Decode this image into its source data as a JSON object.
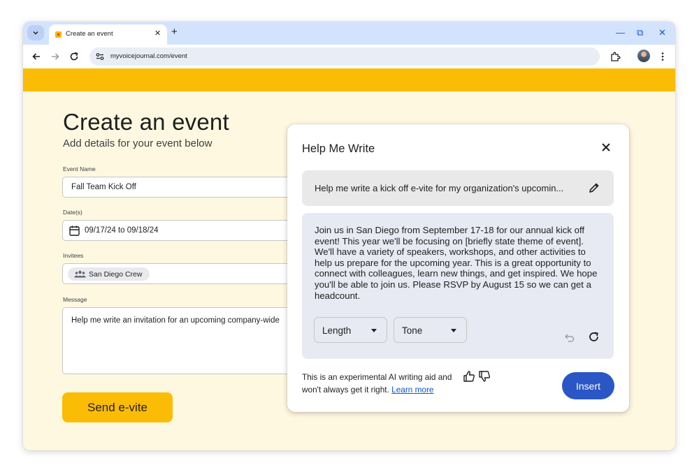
{
  "browser": {
    "tab_title": "Create an event",
    "new_tab_symbol": "+",
    "tab_close_symbol": "✕",
    "url": "myvoicejournal.com/event",
    "minimize_symbol": "—",
    "restore_symbol": "⧉",
    "close_symbol": "✕"
  },
  "form": {
    "title": "Create an event",
    "subtitle": "Add details for your event below",
    "event_name_label": "Event Name",
    "event_name_value": "Fall Team Kick Off",
    "dates_label": "Date(s)",
    "dates_value": "09/17/24 to 09/18/24",
    "invitees_label": "Invitees",
    "invitee_chip": "San Diego Crew",
    "message_label": "Message",
    "message_value": "Help me write an invitation for an upcoming company-wide",
    "send_button": "Send e-vite"
  },
  "dialog": {
    "title": "Help Me Write",
    "prompt": "Help me write a kick off e-vite for my organization's upcomin...",
    "result": "Join us in San Diego from September 17-18 for our annual kick off event! This year we'll be focusing on [briefly state theme of event]. We'll have a variety of speakers, workshops, and other activities to help us prepare for the upcoming year. This is a great opportunity to connect with colleagues, learn new things, and get inspired. We hope you'll be able to join us. Please RSVP by August 15 so we can get a headcount.",
    "length_label": "Length",
    "tone_label": "Tone",
    "disclaimer_line1": "This is an experimental AI writing aid and",
    "disclaimer_line2": "won't always get it right.",
    "learn_more": "Learn more",
    "insert_button": "Insert"
  },
  "colors": {
    "brand_yellow": "#fbbc05",
    "page_background": "#fff8e1",
    "insert_blue": "#2a56c6",
    "tabstrip_blue": "#d3e3fd"
  },
  "icons": [
    "chevron-down-icon",
    "favicon-icon",
    "back-arrow-icon",
    "forward-arrow-icon",
    "reload-icon",
    "site-settings-icon",
    "extensions-icon",
    "more-vert-icon",
    "calendar-icon",
    "group-icon",
    "close-icon",
    "pencil-icon",
    "undo-icon",
    "refresh-icon",
    "thumb-up-icon",
    "thumb-down-icon"
  ]
}
